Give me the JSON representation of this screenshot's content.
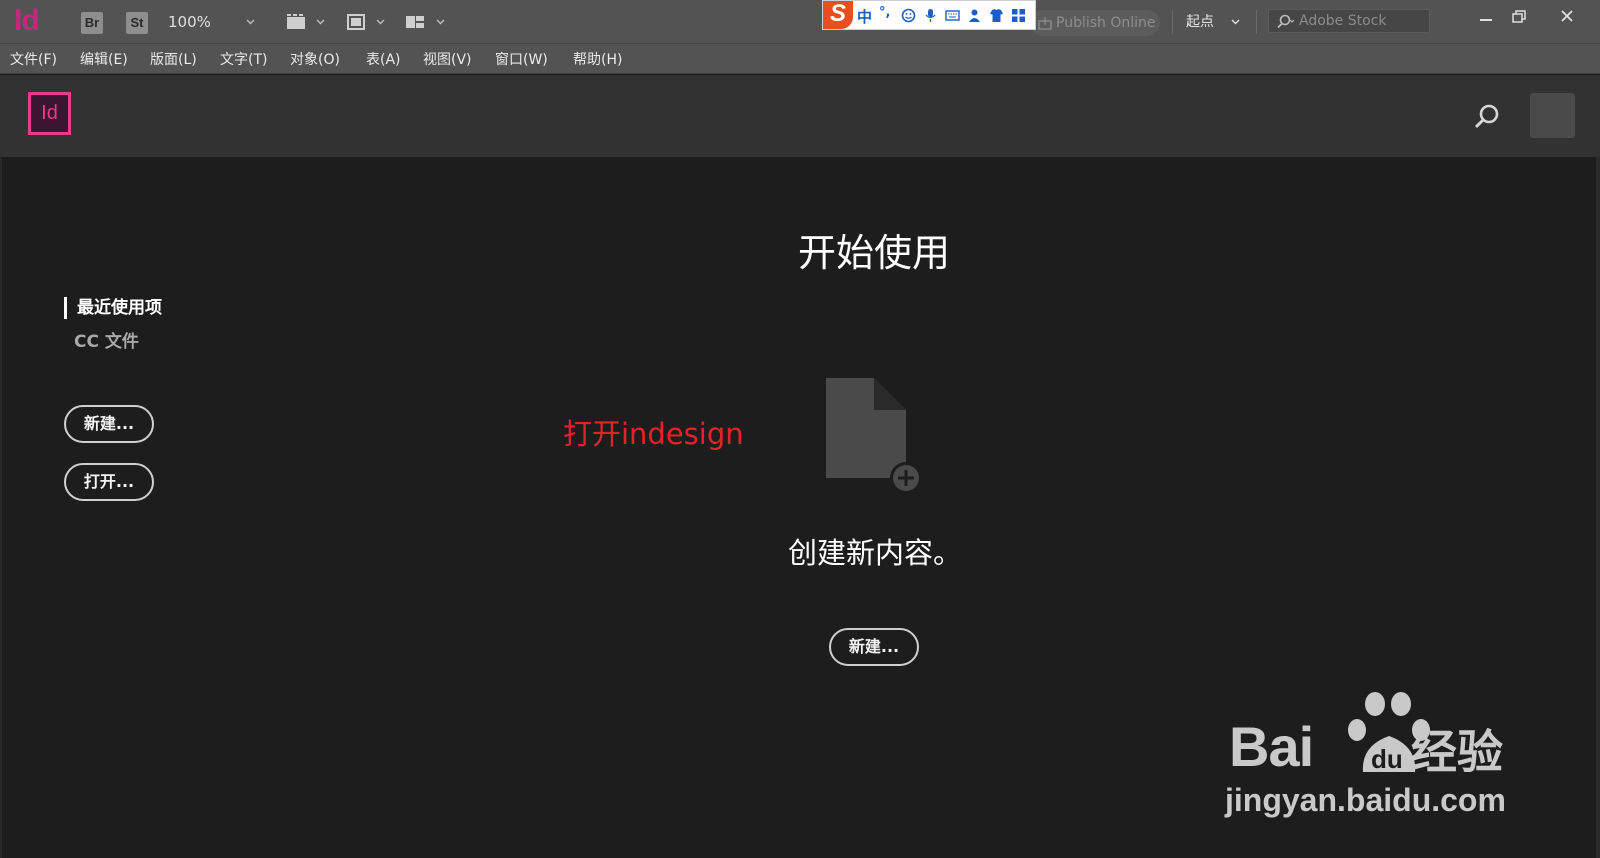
{
  "appbar": {
    "app_logo": "Id",
    "bridge_label": "Br",
    "stock_app_label": "St",
    "zoom": "100%",
    "publish_label": "Publish Online",
    "workspace": "起点",
    "stock_search_placeholder": "Adobe Stock"
  },
  "ime": {
    "mode": "中",
    "punct": "°,"
  },
  "menu": {
    "items": [
      "文件(F)",
      "编辑(E)",
      "版面(L)",
      "文字(T)",
      "对象(O)",
      "表(A)",
      "视图(V)",
      "窗口(W)",
      "帮助(H)"
    ]
  },
  "home": {
    "badge": "Id",
    "nav_recent": "最近使用项",
    "nav_cc": "CC 文件",
    "left_new": "新建...",
    "left_open": "打开...",
    "title": "开始使用",
    "annotation": "打开indesign",
    "create_text": "创建新内容。",
    "center_new": "新建..."
  },
  "watermark": {
    "brand": "Bai",
    "paw_text": "du",
    "jingyan": "经验",
    "url": "jingyan.baidu.com"
  },
  "colors": {
    "accent": "#e93a8c",
    "annotation": "#e8202a",
    "background": "#1d1d1d"
  }
}
